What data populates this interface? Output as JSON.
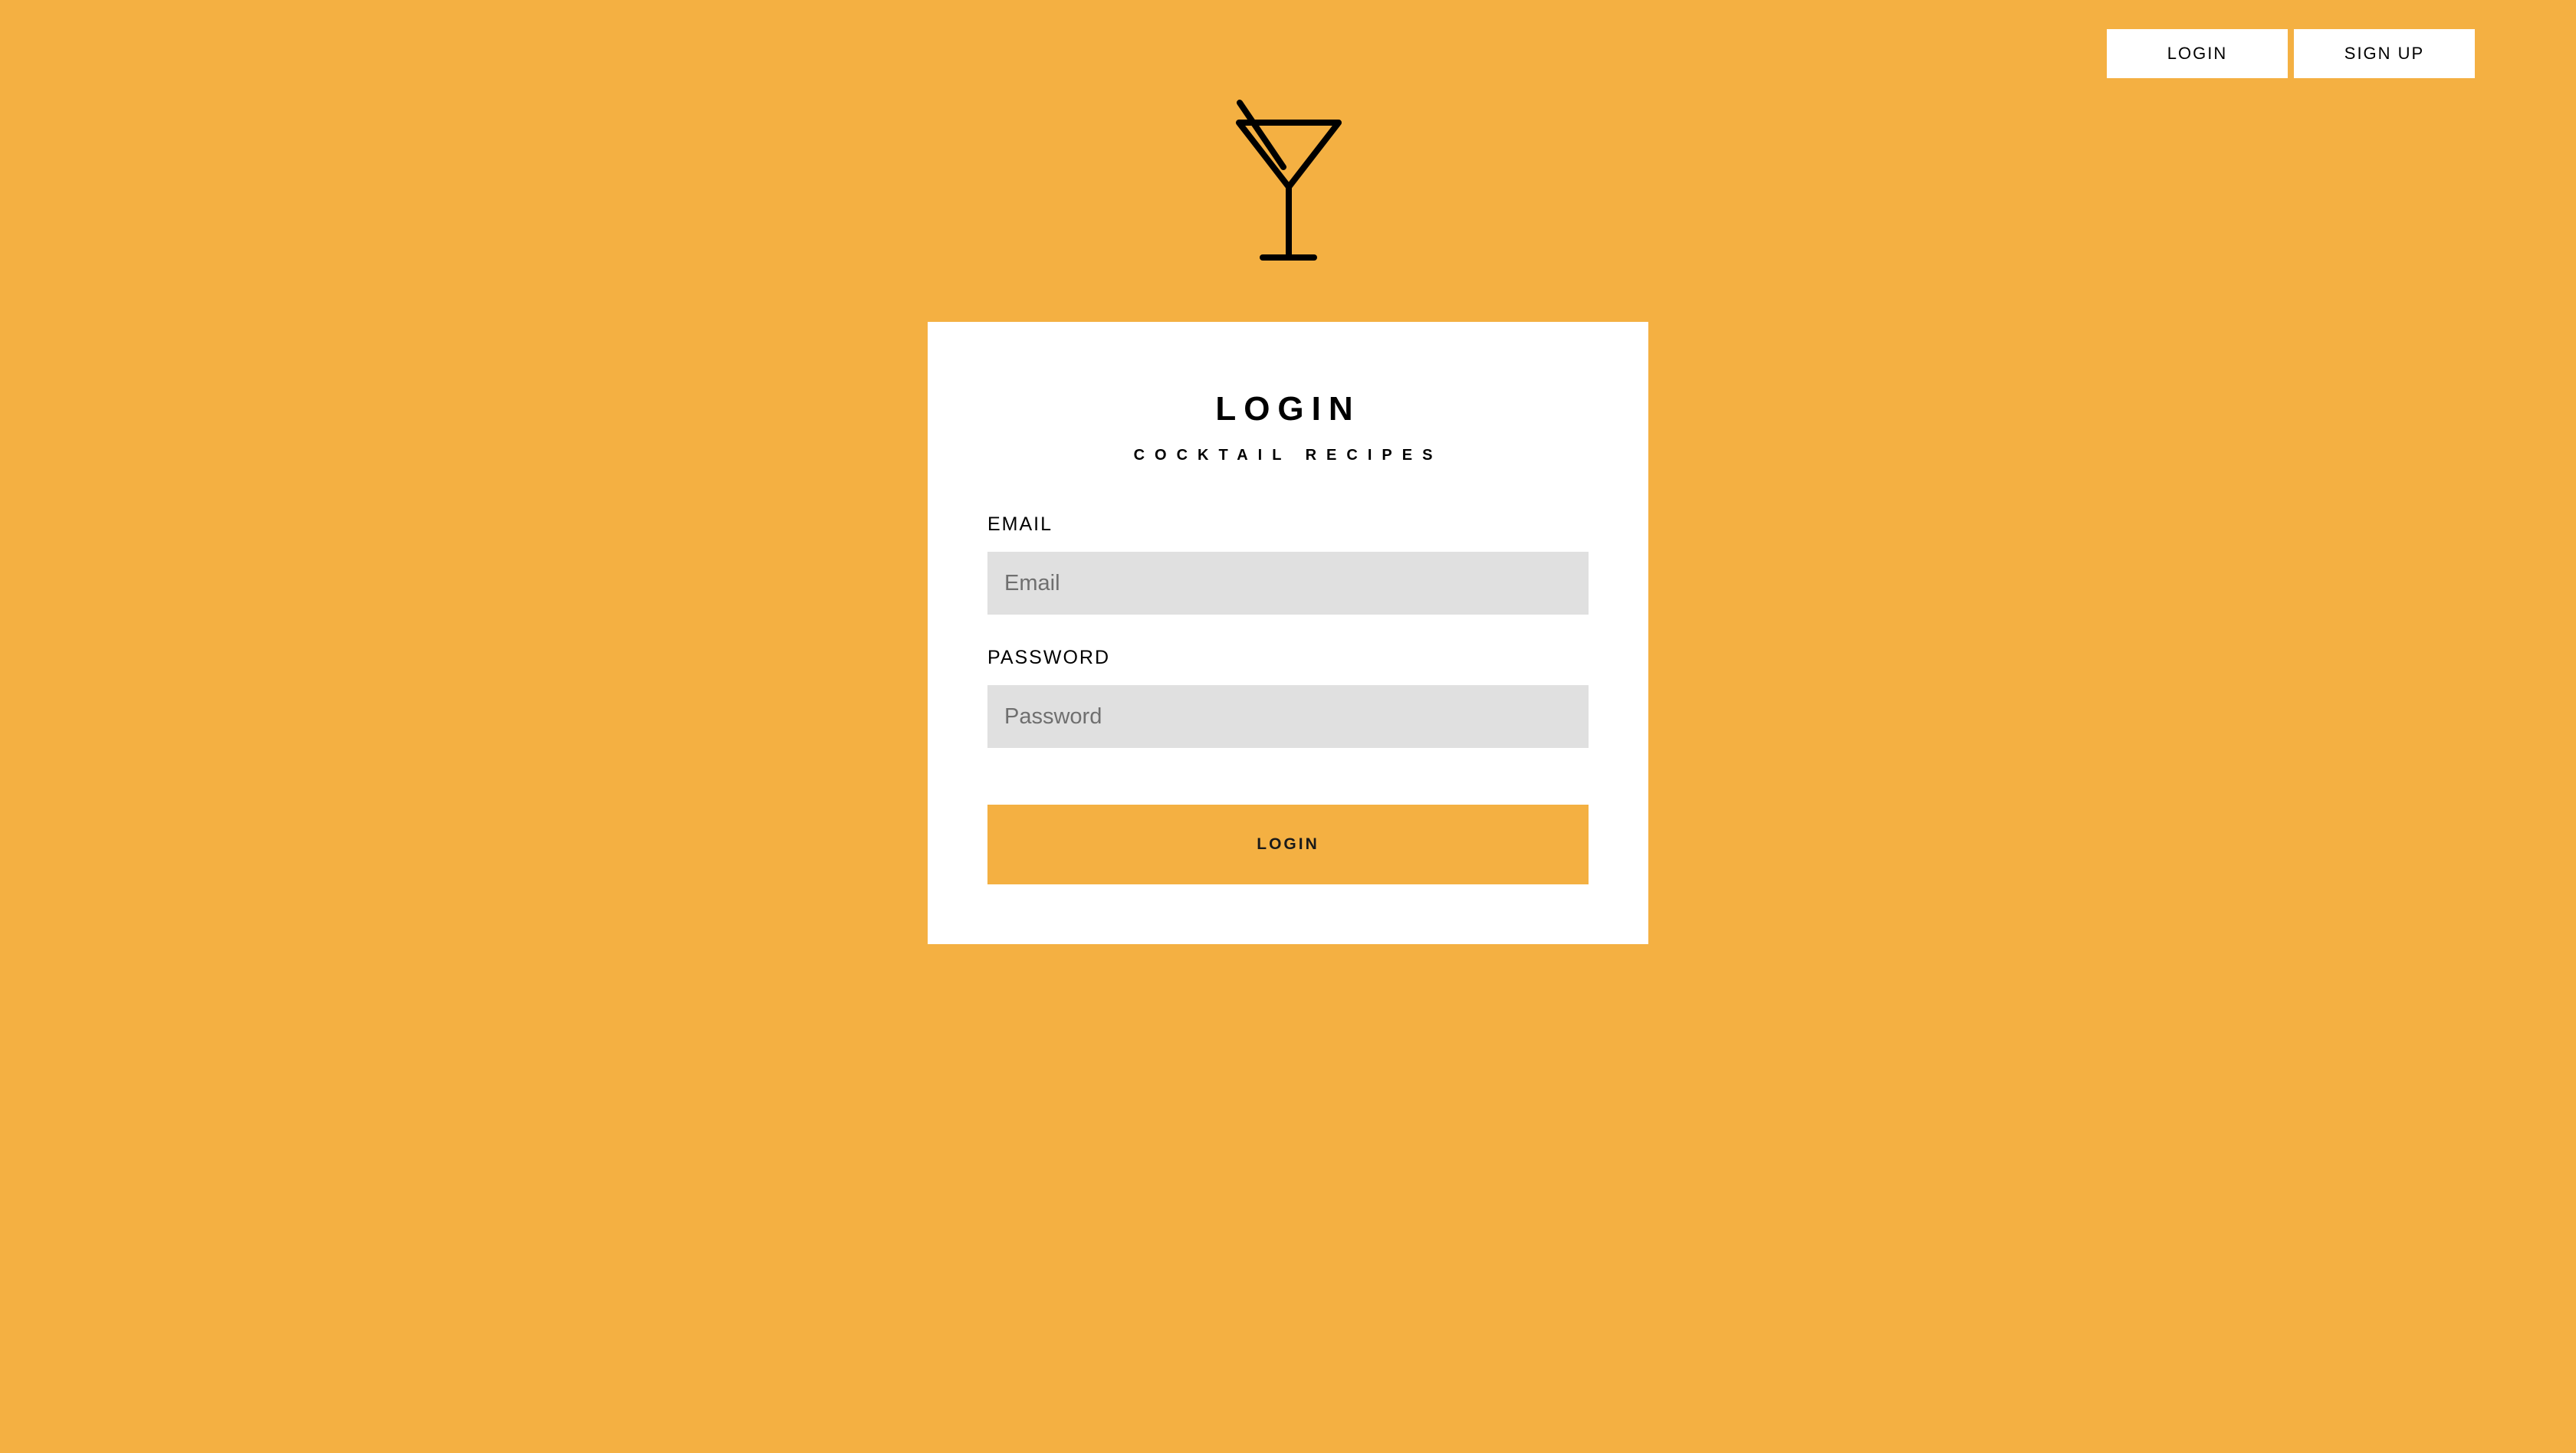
{
  "nav": {
    "login_label": "LOGIN",
    "signup_label": "SIGN UP"
  },
  "logo": {
    "icon": "martini-glass-icon"
  },
  "card": {
    "title": "LOGIN",
    "subtitle": "COCKTAIL RECIPES",
    "email_label": "EMAIL",
    "email_placeholder": "Email",
    "email_value": "",
    "password_label": "PASSWORD",
    "password_placeholder": "Password",
    "password_value": "",
    "submit_label": "LOGIN"
  },
  "colors": {
    "background": "#f4b042",
    "card": "#ffffff",
    "input": "#e0e0e0",
    "accent": "#f4b042"
  }
}
